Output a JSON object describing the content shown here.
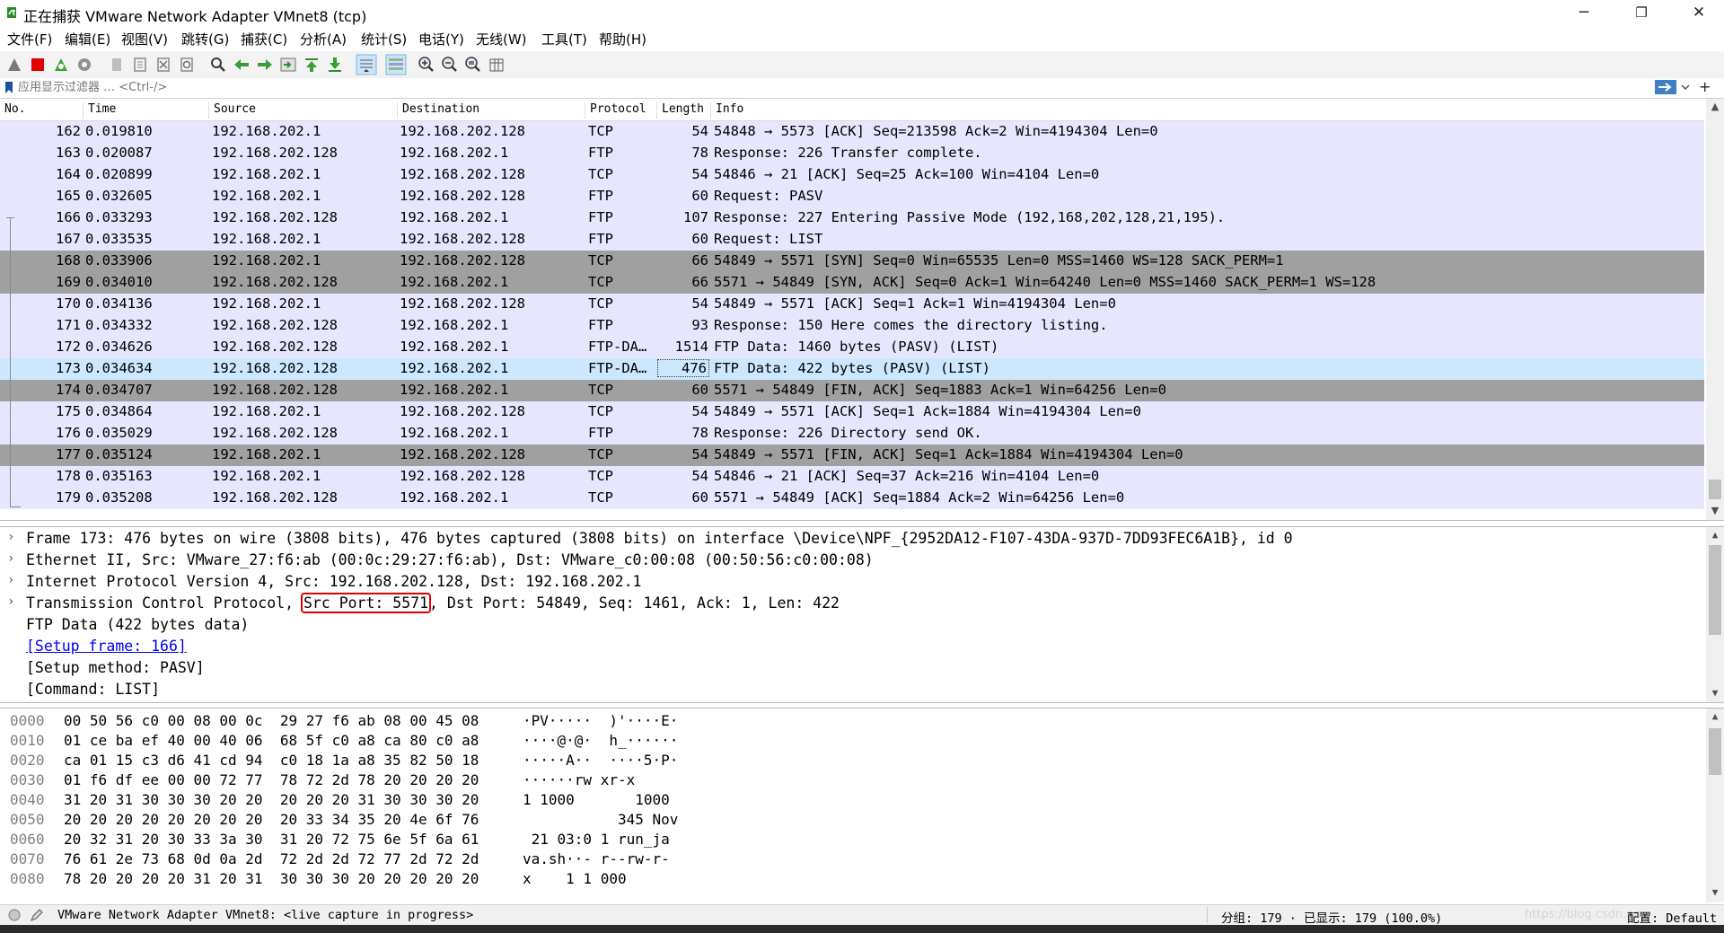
{
  "window": {
    "title": "正在捕获 VMware Network Adapter VMnet8 (tcp)",
    "minimize": "─",
    "maximize": "❐",
    "close": "✕"
  },
  "menu": [
    "文件(F)",
    "编辑(E)",
    "视图(V)",
    "跳转(G)",
    "捕获(C)",
    "分析(A)",
    "统计(S)",
    "电话(Y)",
    "无线(W)",
    "工具(T)",
    "帮助(H)"
  ],
  "filter": {
    "placeholder": "应用显示过滤器 … <Ctrl-/>",
    "add_label": "+"
  },
  "columns": [
    "No.",
    "Time",
    "Source",
    "Destination",
    "Protocol",
    "Length",
    "Info"
  ],
  "packets": [
    {
      "no": "162",
      "time": "0.019810",
      "src": "192.168.202.1",
      "dst": "192.168.202.128",
      "proto": "TCP",
      "len": "54",
      "info": "54848 → 5573 [ACK] Seq=213598 Ack=2 Win=4194304 Len=0",
      "style": "light"
    },
    {
      "no": "163",
      "time": "0.020087",
      "src": "192.168.202.128",
      "dst": "192.168.202.1",
      "proto": "FTP",
      "len": "78",
      "info": "Response: 226 Transfer complete.",
      "style": "light"
    },
    {
      "no": "164",
      "time": "0.020899",
      "src": "192.168.202.1",
      "dst": "192.168.202.128",
      "proto": "TCP",
      "len": "54",
      "info": "54846 → 21 [ACK] Seq=25 Ack=100 Win=4104 Len=0",
      "style": "light"
    },
    {
      "no": "165",
      "time": "0.032605",
      "src": "192.168.202.1",
      "dst": "192.168.202.128",
      "proto": "FTP",
      "len": "60",
      "info": "Request: PASV",
      "style": "light"
    },
    {
      "no": "166",
      "time": "0.033293",
      "src": "192.168.202.128",
      "dst": "192.168.202.1",
      "proto": "FTP",
      "len": "107",
      "info": "Response: 227 Entering Passive Mode (192,168,202,128,21,195).",
      "style": "light"
    },
    {
      "no": "167",
      "time": "0.033535",
      "src": "192.168.202.1",
      "dst": "192.168.202.128",
      "proto": "FTP",
      "len": "60",
      "info": "Request: LIST",
      "style": "light"
    },
    {
      "no": "168",
      "time": "0.033906",
      "src": "192.168.202.1",
      "dst": "192.168.202.128",
      "proto": "TCP",
      "len": "66",
      "info": "54849 → 5571 [SYN] Seq=0 Win=65535 Len=0 MSS=1460 WS=128 SACK_PERM=1",
      "style": "dark"
    },
    {
      "no": "169",
      "time": "0.034010",
      "src": "192.168.202.128",
      "dst": "192.168.202.1",
      "proto": "TCP",
      "len": "66",
      "info": "5571 → 54849 [SYN, ACK] Seq=0 Ack=1 Win=64240 Len=0 MSS=1460 SACK_PERM=1 WS=128",
      "style": "dark"
    },
    {
      "no": "170",
      "time": "0.034136",
      "src": "192.168.202.1",
      "dst": "192.168.202.128",
      "proto": "TCP",
      "len": "54",
      "info": "54849 → 5571 [ACK] Seq=1 Ack=1 Win=4194304 Len=0",
      "style": "light"
    },
    {
      "no": "171",
      "time": "0.034332",
      "src": "192.168.202.128",
      "dst": "192.168.202.1",
      "proto": "FTP",
      "len": "93",
      "info": "Response: 150 Here comes the directory listing.",
      "style": "light"
    },
    {
      "no": "172",
      "time": "0.034626",
      "src": "192.168.202.128",
      "dst": "192.168.202.1",
      "proto": "FTP-DA…",
      "len": "1514",
      "info": "FTP Data: 1460 bytes (PASV) (LIST)",
      "style": "light"
    },
    {
      "no": "173",
      "time": "0.034634",
      "src": "192.168.202.128",
      "dst": "192.168.202.1",
      "proto": "FTP-DA…",
      "len": "476",
      "info": "FTP Data: 422 bytes (PASV) (LIST)",
      "style": "selected"
    },
    {
      "no": "174",
      "time": "0.034707",
      "src": "192.168.202.128",
      "dst": "192.168.202.1",
      "proto": "TCP",
      "len": "60",
      "info": "5571 → 54849 [FIN, ACK] Seq=1883 Ack=1 Win=64256 Len=0",
      "style": "dark"
    },
    {
      "no": "175",
      "time": "0.034864",
      "src": "192.168.202.1",
      "dst": "192.168.202.128",
      "proto": "TCP",
      "len": "54",
      "info": "54849 → 5571 [ACK] Seq=1 Ack=1884 Win=4194304 Len=0",
      "style": "light"
    },
    {
      "no": "176",
      "time": "0.035029",
      "src": "192.168.202.128",
      "dst": "192.168.202.1",
      "proto": "FTP",
      "len": "78",
      "info": "Response: 226 Directory send OK.",
      "style": "light"
    },
    {
      "no": "177",
      "time": "0.035124",
      "src": "192.168.202.1",
      "dst": "192.168.202.128",
      "proto": "TCP",
      "len": "54",
      "info": "54849 → 5571 [FIN, ACK] Seq=1 Ack=1884 Win=4194304 Len=0",
      "style": "dark"
    },
    {
      "no": "178",
      "time": "0.035163",
      "src": "192.168.202.1",
      "dst": "192.168.202.128",
      "proto": "TCP",
      "len": "54",
      "info": "54846 → 21 [ACK] Seq=37 Ack=216 Win=4104 Len=0",
      "style": "light"
    },
    {
      "no": "179",
      "time": "0.035208",
      "src": "192.168.202.128",
      "dst": "192.168.202.1",
      "proto": "TCP",
      "len": "60",
      "info": "5571 → 54849 [ACK] Seq=1884 Ack=2 Win=64256 Len=0",
      "style": "light"
    }
  ],
  "details": {
    "frame": "Frame 173: 476 bytes on wire (3808 bits), 476 bytes captured (3808 bits) on interface \\Device\\NPF_{2952DA12-F107-43DA-937D-7DD93FEC6A1B}, id 0",
    "ethernet": "Ethernet II, Src: VMware_27:f6:ab (00:0c:29:27:f6:ab), Dst: VMware_c0:00:08 (00:50:56:c0:00:08)",
    "ip": "Internet Protocol Version 4, Src: 192.168.202.128, Dst: 192.168.202.1",
    "tcp_prefix": "Transmission Control Protocol, ",
    "tcp_highlight": "Src Port: 5571",
    "tcp_suffix": ", Dst Port: 54849, Seq: 1461, Ack: 1, Len: 422",
    "ftpdata": "FTP Data (422 bytes data)",
    "setup_frame": "[Setup frame: 166]",
    "setup_method": "[Setup method: PASV]",
    "command": "[Command: LIST]"
  },
  "bytes": [
    {
      "off": "0000",
      "hex": "00 50 56 c0 00 08 00 0c  29 27 f6 ab 08 00 45 08",
      "asc": "·PV·····  )'····E·"
    },
    {
      "off": "0010",
      "hex": "01 ce ba ef 40 00 40 06  68 5f c0 a8 ca 80 c0 a8",
      "asc": "····@·@·  h_······"
    },
    {
      "off": "0020",
      "hex": "ca 01 15 c3 d6 41 cd 94  c0 18 1a a8 35 82 50 18",
      "asc": "·····A··  ····5·P·"
    },
    {
      "off": "0030",
      "hex": "01 f6 df ee 00 00 72 77  78 72 2d 78 20 20 20 20",
      "asc": "······rw xr-x    "
    },
    {
      "off": "0040",
      "hex": "31 20 31 30 30 30 20 20  20 20 20 31 30 30 30 20",
      "asc": "1 1000       1000 "
    },
    {
      "off": "0050",
      "hex": "20 20 20 20 20 20 20 20  20 33 34 35 20 4e 6f 76",
      "asc": "           345 Nov"
    },
    {
      "off": "0060",
      "hex": "20 32 31 20 30 33 3a 30  31 20 72 75 6e 5f 6a 61",
      "asc": " 21 03:0 1 run_ja"
    },
    {
      "off": "0070",
      "hex": "76 61 2e 73 68 0d 0a 2d  72 2d 2d 72 77 2d 72 2d",
      "asc": "va.sh··- r--rw-r-"
    },
    {
      "off": "0080",
      "hex": "78 20 20 20 20 31 20 31  30 30 30 20 20 20 20 20",
      "asc": "x    1 1 000     "
    }
  ],
  "status": {
    "capture": "VMware Network Adapter VMnet8: <live capture in progress>",
    "counts": "分组: 179 · 已显示: 179 (100.0%)",
    "profile": "配置: Default",
    "watermark": "https://blog.csdn.ne"
  },
  "colors": {
    "row_light": "#e7e6ff",
    "row_dark": "#a0a0a0",
    "row_selected": "#cce8ff",
    "link": "#0000ee",
    "highlight_box": "#e00000"
  }
}
